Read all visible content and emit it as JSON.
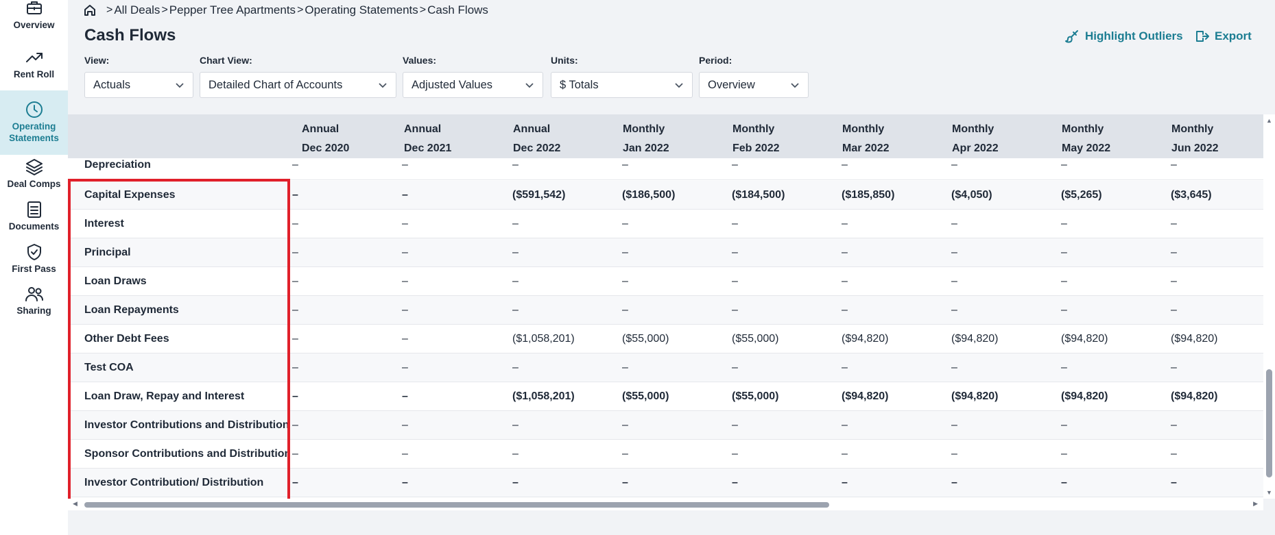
{
  "sidebar": {
    "items": [
      {
        "label": "Overview",
        "icon": "briefcase-icon"
      },
      {
        "label": "Rent Roll",
        "icon": "trending-up-icon"
      },
      {
        "label": "Operating Statements",
        "icon": "clock-icon",
        "active": true
      },
      {
        "label": "Deal Comps",
        "icon": "layers-icon"
      },
      {
        "label": "Documents",
        "icon": "document-icon"
      },
      {
        "label": "First Pass",
        "icon": "shield-check-icon"
      },
      {
        "label": "Sharing",
        "icon": "users-icon"
      }
    ]
  },
  "breadcrumb": {
    "items": [
      "All Deals",
      "Pepper Tree Apartments",
      "Operating Statements",
      "Cash Flows"
    ],
    "separator": ">"
  },
  "page": {
    "title": "Cash Flows",
    "highlight_label": "Highlight Outliers",
    "export_label": "Export"
  },
  "filters": {
    "view": {
      "label": "View:",
      "value": "Actuals"
    },
    "chart_view": {
      "label": "Chart View:",
      "value": "Detailed Chart of Accounts"
    },
    "values": {
      "label": "Values:",
      "value": "Adjusted Values"
    },
    "units": {
      "label": "Units:",
      "value": "$ Totals"
    },
    "period": {
      "label": "Period:",
      "value": "Overview"
    }
  },
  "table": {
    "columns": [
      {
        "line1": "Annual",
        "line2": "Dec 2020"
      },
      {
        "line1": "Annual",
        "line2": "Dec 2021"
      },
      {
        "line1": "Annual",
        "line2": "Dec 2022"
      },
      {
        "line1": "Monthly",
        "line2": "Jan 2022"
      },
      {
        "line1": "Monthly",
        "line2": "Feb 2022"
      },
      {
        "line1": "Monthly",
        "line2": "Mar 2022"
      },
      {
        "line1": "Monthly",
        "line2": "Apr 2022"
      },
      {
        "line1": "Monthly",
        "line2": "May 2022"
      },
      {
        "line1": "Monthly",
        "line2": "Jun 2022"
      }
    ],
    "partial_row": {
      "name": "Depreciation",
      "values": [
        "–",
        "–",
        "–",
        "–",
        "–",
        "–",
        "–",
        "–",
        "–"
      ]
    },
    "rows": [
      {
        "name": "Capital Expenses",
        "bold": true,
        "values": [
          "–",
          "–",
          "($591,542)",
          "($186,500)",
          "($184,500)",
          "($185,850)",
          "($4,050)",
          "($5,265)",
          "($3,645)"
        ]
      },
      {
        "name": "Interest",
        "bold": false,
        "values": [
          "–",
          "–",
          "–",
          "–",
          "–",
          "–",
          "–",
          "–",
          "–"
        ]
      },
      {
        "name": "Principal",
        "bold": false,
        "values": [
          "–",
          "–",
          "–",
          "–",
          "–",
          "–",
          "–",
          "–",
          "–"
        ]
      },
      {
        "name": "Loan Draws",
        "bold": false,
        "values": [
          "–",
          "–",
          "–",
          "–",
          "–",
          "–",
          "–",
          "–",
          "–"
        ]
      },
      {
        "name": "Loan Repayments",
        "bold": false,
        "values": [
          "–",
          "–",
          "–",
          "–",
          "–",
          "–",
          "–",
          "–",
          "–"
        ]
      },
      {
        "name": "Other Debt Fees",
        "bold": false,
        "values": [
          "–",
          "–",
          "($1,058,201)",
          "($55,000)",
          "($55,000)",
          "($94,820)",
          "($94,820)",
          "($94,820)",
          "($94,820)"
        ]
      },
      {
        "name": "Test COA",
        "bold": false,
        "values": [
          "–",
          "–",
          "–",
          "–",
          "–",
          "–",
          "–",
          "–",
          "–"
        ]
      },
      {
        "name": "Loan Draw, Repay and Interest",
        "bold": true,
        "values": [
          "–",
          "–",
          "($1,058,201)",
          "($55,000)",
          "($55,000)",
          "($94,820)",
          "($94,820)",
          "($94,820)",
          "($94,820)"
        ]
      },
      {
        "name": "Investor Contributions and Distributions",
        "bold": false,
        "values": [
          "–",
          "–",
          "–",
          "–",
          "–",
          "–",
          "–",
          "–",
          "–"
        ]
      },
      {
        "name": "Sponsor Contributions and Distributions",
        "bold": false,
        "values": [
          "–",
          "–",
          "–",
          "–",
          "–",
          "–",
          "–",
          "–",
          "–"
        ]
      },
      {
        "name": "Investor Contribution/ Distribution",
        "bold": true,
        "values": [
          "–",
          "–",
          "–",
          "–",
          "–",
          "–",
          "–",
          "–",
          "–"
        ]
      }
    ]
  },
  "colors": {
    "accent": "#1c7d92",
    "active_nav_bg": "#d7ecf2",
    "highlight_border": "#e0202a",
    "header_bg": "#dfe3e9"
  }
}
